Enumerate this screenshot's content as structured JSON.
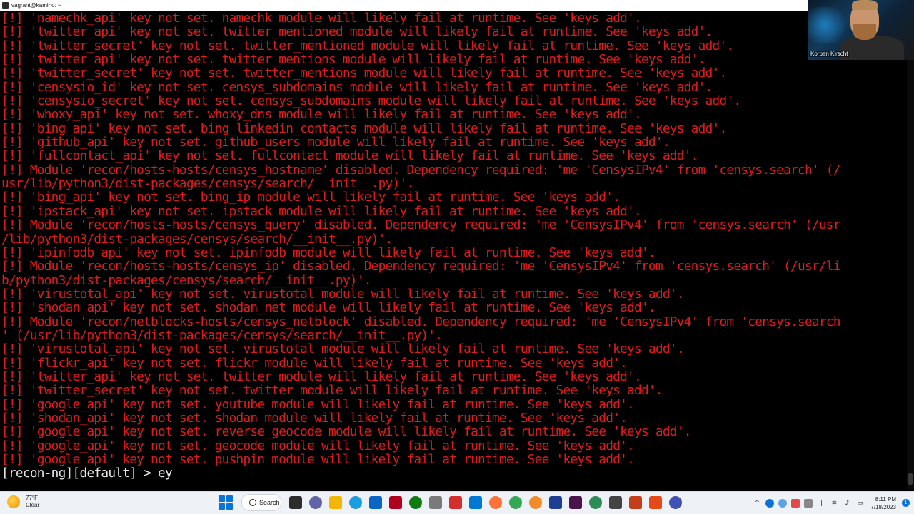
{
  "window": {
    "title": "vagrant@kamino: ~"
  },
  "terminal": {
    "lines": [
      "[!] 'namechk_api' key not set. namechk module will likely fail at runtime. See 'keys add'.",
      "[!] 'twitter_api' key not set. twitter_mentioned module will likely fail at runtime. See 'keys add'.",
      "[!] 'twitter_secret' key not set. twitter_mentioned module will likely fail at runtime. See 'keys add'.",
      "[!] 'twitter_api' key not set. twitter_mentions module will likely fail at runtime. See 'keys add'.",
      "[!] 'twitter_secret' key not set. twitter_mentions module will likely fail at runtime. See 'keys add'.",
      "[!] 'censysio_id' key not set. censys_subdomains module will likely fail at runtime. See 'keys add'.",
      "[!] 'censysio_secret' key not set. censys_subdomains module will likely fail at runtime. See 'keys add'.",
      "[!] 'whoxy_api' key not set. whoxy_dns module will likely fail at runtime. See 'keys add'.",
      "[!] 'bing_api' key not set. bing_linkedin_contacts module will likely fail at runtime. See 'keys add'.",
      "[!] 'github_api' key not set. github_users module will likely fail at runtime. See 'keys add'.",
      "[!] 'fullcontact_api' key not set. fullcontact module will likely fail at runtime. See 'keys add'.",
      "[!] Module 'recon/hosts-hosts/censys_hostname' disabled. Dependency required: 'me 'CensysIPv4' from 'censys.search' (/",
      "usr/lib/python3/dist-packages/censys/search/__init__.py)'.",
      "[!] 'bing_api' key not set. bing_ip module will likely fail at runtime. See 'keys add'.",
      "[!] 'ipstack_api' key not set. ipstack module will likely fail at runtime. See 'keys add'.",
      "[!] Module 'recon/hosts-hosts/censys_query' disabled. Dependency required: 'me 'CensysIPv4' from 'censys.search' (/usr",
      "/lib/python3/dist-packages/censys/search/__init__.py)'.",
      "[!] 'ipinfodb_api' key not set. ipinfodb module will likely fail at runtime. See 'keys add'.",
      "[!] Module 'recon/hosts-hosts/censys_ip' disabled. Dependency required: 'me 'CensysIPv4' from 'censys.search' (/usr/li",
      "b/python3/dist-packages/censys/search/__init__.py)'.",
      "[!] 'virustotal_api' key not set. virustotal module will likely fail at runtime. See 'keys add'.",
      "[!] 'shodan_api' key not set. shodan_net module will likely fail at runtime. See 'keys add'.",
      "[!] Module 'recon/netblocks-hosts/censys_netblock' disabled. Dependency required: 'me 'CensysIPv4' from 'censys.search",
      "' (/usr/lib/python3/dist-packages/censys/search/__init__.py)'.",
      "[!] 'virustotal_api' key not set. virustotal module will likely fail at runtime. See 'keys add'.",
      "[!] 'flickr_api' key not set. flickr module will likely fail at runtime. See 'keys add'.",
      "[!] 'twitter_api' key not set. twitter module will likely fail at runtime. See 'keys add'.",
      "[!] 'twitter_secret' key not set. twitter module will likely fail at runtime. See 'keys add'.",
      "[!] 'google_api' key not set. youtube module will likely fail at runtime. See 'keys add'.",
      "[!] 'shodan_api' key not set. shodan module will likely fail at runtime. See 'keys add'.",
      "[!] 'google_api' key not set. reverse_geocode module will likely fail at runtime. See 'keys add'.",
      "[!] 'google_api' key not set. geocode module will likely fail at runtime. See 'keys add'.",
      "[!] 'google_api' key not set. pushpin module will likely fail at runtime. See 'keys add'."
    ],
    "prompt": "[recon-ng][default] > ey"
  },
  "webcam": {
    "name": "Korben Kirscht"
  },
  "taskbar": {
    "weather": {
      "temp": "77°F",
      "condition": "Clear"
    },
    "search_label": "Search",
    "clock": {
      "time": "8:11 PM",
      "date": "7/18/2023"
    },
    "notification_count": "1"
  }
}
